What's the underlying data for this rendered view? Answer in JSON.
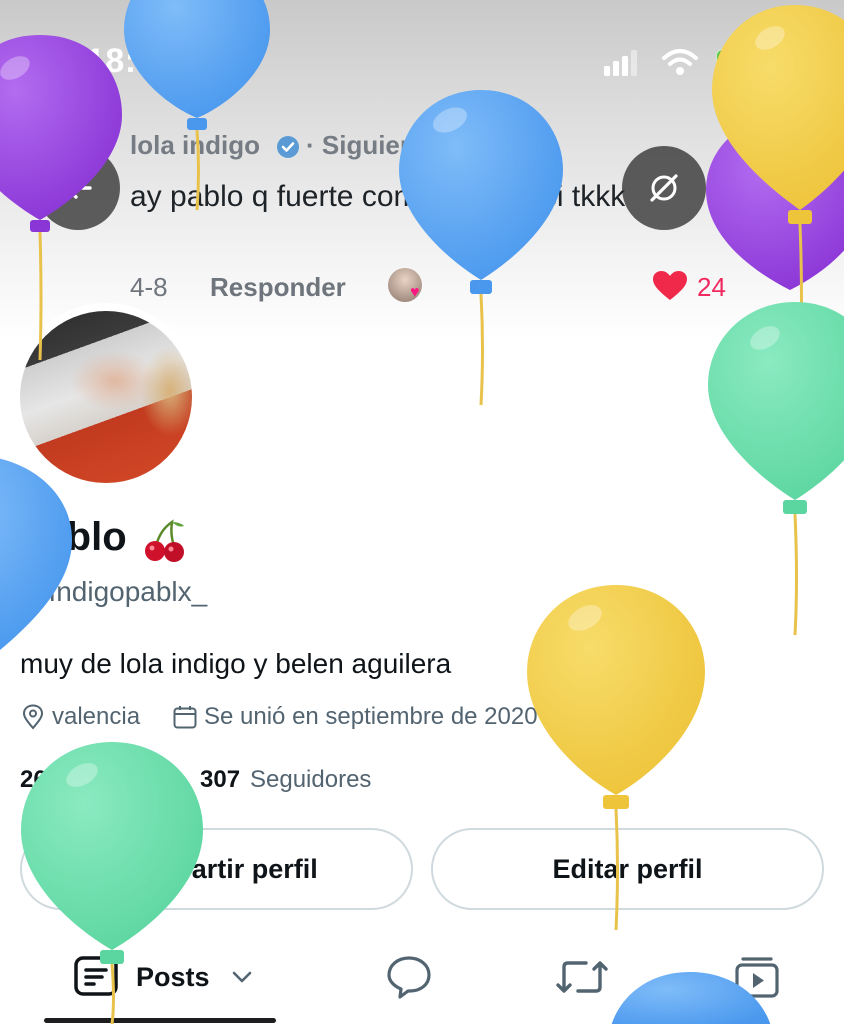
{
  "status_bar": {
    "time": "18:55",
    "battery": "68"
  },
  "comment": {
    "author": "lola indigo",
    "follow_status": "· Siguiendo",
    "text": "ay pablo q fuerte como has creci tkkk",
    "date": "4-8",
    "reply_label": "Responder",
    "likes": "24"
  },
  "profile": {
    "name": "pablo",
    "handle": "@Indigopablx_",
    "bio": "muy de lola indigo y belen aguilera",
    "location": "valencia",
    "joined": "Se unió en septiembre de 2020",
    "following_count": "268",
    "following_label": "Siguiendo",
    "followers_count": "307",
    "followers_label": "Seguidores"
  },
  "buttons": {
    "share": "Compartir perfil",
    "edit": "Editar perfil"
  },
  "tabs": {
    "posts_label": "Posts"
  },
  "balloon_colors": {
    "purple": "#9b46e0",
    "blue": "#5aa8f5",
    "yellow": "#f2cd45",
    "green": "#6ee0ac"
  },
  "icons": [
    "location-arrow-icon",
    "signal-icon",
    "wifi-icon",
    "battery-icon",
    "back-arrow-icon",
    "hide-icon",
    "verified-icon",
    "heart-icon",
    "cherry-icon",
    "pin-icon",
    "calendar-icon",
    "posts-icon",
    "reply-icon",
    "retweet-icon",
    "media-icon"
  ]
}
